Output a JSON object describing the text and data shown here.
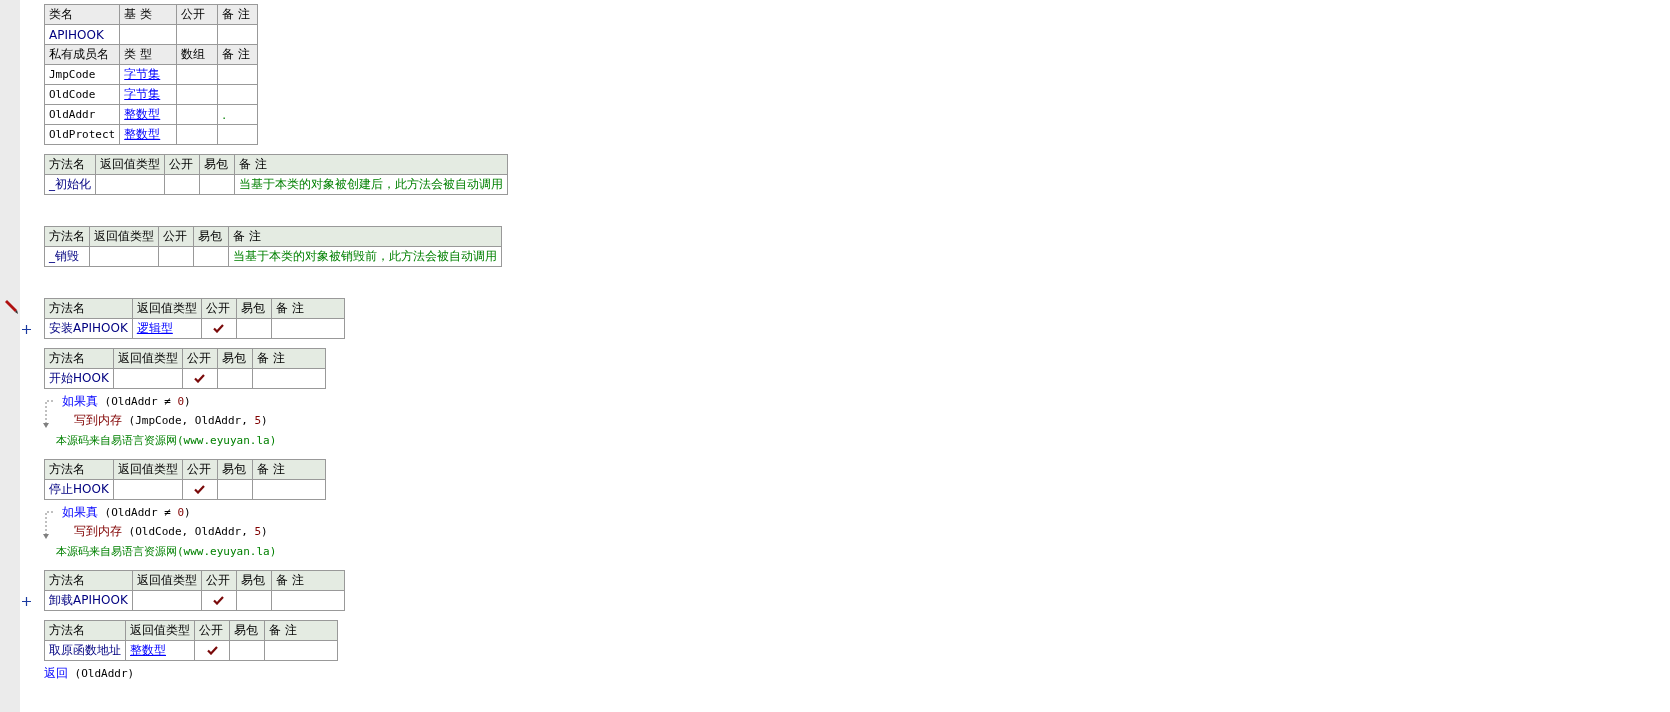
{
  "class_table": {
    "header": [
      "类名",
      "基 类",
      "公开",
      "备 注"
    ],
    "name": "APIHOOK"
  },
  "member_table": {
    "header": [
      "私有成员名",
      "类 型",
      "数组",
      "备 注"
    ],
    "rows": [
      {
        "name": "JmpCode",
        "type": "字节集"
      },
      {
        "name": "OldCode",
        "type": "字节集"
      },
      {
        "name": "OldAddr",
        "type": "整数型",
        "note": "."
      },
      {
        "name": "OldProtect",
        "type": "整数型"
      }
    ]
  },
  "methods": [
    {
      "header": [
        "方法名",
        "返回值类型",
        "公开",
        "易包",
        "备 注"
      ],
      "name": "_初始化",
      "public": false,
      "note": "当基于本类的对象被创建后，此方法会被自动调用",
      "editing": false,
      "collapsed": false,
      "body": [
        {
          "kind": "blank"
        }
      ]
    },
    {
      "header": [
        "方法名",
        "返回值类型",
        "公开",
        "易包",
        "备 注"
      ],
      "name": "_销毁",
      "public": false,
      "note": "当基于本类的对象被销毁前，此方法会被自动调用",
      "editing": false,
      "collapsed": false,
      "body": [
        {
          "kind": "blank"
        }
      ]
    },
    {
      "header": [
        "方法名",
        "返回值类型",
        "公开",
        "易包",
        "备 注"
      ],
      "name": "安装APIHOOK",
      "return_type": "逻辑型",
      "public": true,
      "editing": true,
      "collapsed": true
    },
    {
      "header": [
        "方法名",
        "返回值类型",
        "公开",
        "易包",
        "备 注"
      ],
      "name": "开始HOOK",
      "public": true,
      "editing": false,
      "collapsed": false,
      "body": [
        {
          "kind": "if",
          "tokens": [
            {
              "text": "如果真",
              "kind": "keyword"
            },
            {
              "text": " (OldAddr ≠ ",
              "kind": "plain"
            },
            {
              "text": "0",
              "kind": "constant"
            },
            {
              "text": ")",
              "kind": "plain"
            }
          ],
          "children": [
            {
              "kind": "statement",
              "tokens": [
                {
                  "text": "写到内存",
                  "kind": "command"
                },
                {
                  "text": " (JmpCode, OldAddr, ",
                  "kind": "plain"
                },
                {
                  "text": "5",
                  "kind": "constant"
                },
                {
                  "text": ")",
                  "kind": "plain"
                }
              ]
            }
          ]
        },
        {
          "kind": "comment",
          "tokens": [
            {
              "text": "本源码来自易语言资源网(www.eyuyan.la)",
              "kind": "comment"
            }
          ]
        }
      ]
    },
    {
      "header": [
        "方法名",
        "返回值类型",
        "公开",
        "易包",
        "备 注"
      ],
      "name": "停止HOOK",
      "public": true,
      "editing": false,
      "collapsed": false,
      "body": [
        {
          "kind": "if",
          "tokens": [
            {
              "text": "如果真",
              "kind": "keyword"
            },
            {
              "text": " (OldAddr ≠ ",
              "kind": "plain"
            },
            {
              "text": "0",
              "kind": "constant"
            },
            {
              "text": ")",
              "kind": "plain"
            }
          ],
          "children": [
            {
              "kind": "statement",
              "tokens": [
                {
                  "text": "写到内存",
                  "kind": "command"
                },
                {
                  "text": " (OldCode, OldAddr, ",
                  "kind": "plain"
                },
                {
                  "text": "5",
                  "kind": "constant"
                },
                {
                  "text": ")",
                  "kind": "plain"
                }
              ]
            }
          ]
        },
        {
          "kind": "comment",
          "tokens": [
            {
              "text": "本源码来自易语言资源网(www.eyuyan.la)",
              "kind": "comment"
            }
          ]
        }
      ]
    },
    {
      "header": [
        "方法名",
        "返回值类型",
        "公开",
        "易包",
        "备 注"
      ],
      "name": "卸载APIHOOK",
      "public": true,
      "editing": false,
      "collapsed": true
    },
    {
      "header": [
        "方法名",
        "返回值类型",
        "公开",
        "易包",
        "备 注"
      ],
      "name": "取原函数地址",
      "return_type": "整数型",
      "public": true,
      "editing": false,
      "collapsed": false,
      "body": [
        {
          "kind": "statement",
          "tokens": [
            {
              "text": "返回",
              "kind": "keyword"
            },
            {
              "text": " (OldAddr)",
              "kind": "plain"
            }
          ]
        }
      ]
    }
  ]
}
